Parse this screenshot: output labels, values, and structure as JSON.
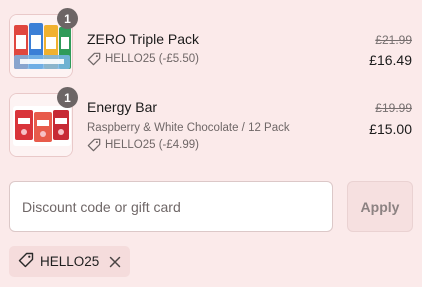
{
  "colors": {
    "background": "#fbeaea",
    "quantity_badge": "#6c6565",
    "muted_text": "#6f6767",
    "apply_button_bg": "#f6e0e0"
  },
  "line_items": [
    {
      "title": "ZERO Triple Pack",
      "quantity": "1",
      "discount": "HELLO25 (-£5.50)",
      "original_price": "£21.99",
      "price": "£16.49",
      "icon": "tag-icon"
    },
    {
      "title": "Energy Bar",
      "variant": "Raspberry & White Chocolate / 12 Pack",
      "quantity": "1",
      "discount": "HELLO25 (-£4.99)",
      "original_price": "£19.99",
      "price": "£15.00",
      "icon": "tag-icon"
    }
  ],
  "discount_form": {
    "placeholder": "Discount code or gift card",
    "value": "",
    "apply_label": "Apply"
  },
  "applied_codes": [
    {
      "code": "HELLO25",
      "icon": "tag-icon",
      "remove_icon": "close-icon"
    }
  ]
}
